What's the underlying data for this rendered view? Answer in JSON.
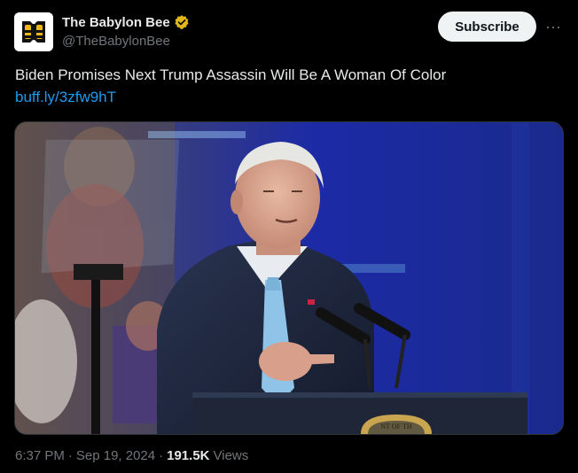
{
  "author": {
    "display_name": "The Babylon Bee",
    "handle": "@TheBabylonBee",
    "avatar_icon": "bee-logo-icon",
    "verified_icon": "verified-badge-icon",
    "verified_color": "#e2b719"
  },
  "subscribe_label": "Subscribe",
  "more_label": "···",
  "tweet": {
    "text": "Biden Promises Next Trump Assassin Will Be A Woman Of Color",
    "link": "buff.ly/3zfw9hT"
  },
  "media": {
    "podium_seal_text": "NT OF TH"
  },
  "meta": {
    "time": "6:37 PM",
    "separator": "·",
    "date": "Sep 19, 2024",
    "views_count": "191.5K",
    "views_label": "Views"
  },
  "colors": {
    "background": "#000000",
    "text": "#e7e9ea",
    "secondary": "#71767b",
    "link": "#1d9bf0",
    "button_bg": "#eff3f4"
  }
}
